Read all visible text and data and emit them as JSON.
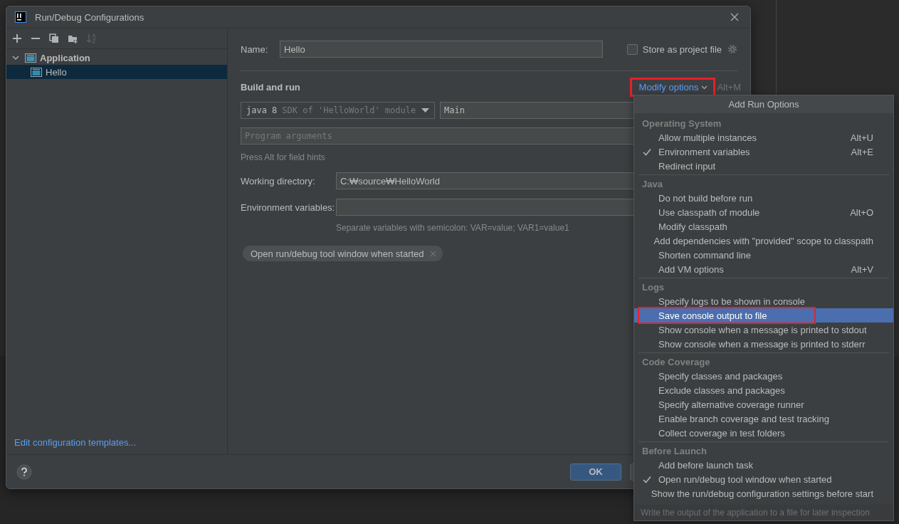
{
  "window": {
    "title": "Run/Debug Configurations"
  },
  "toolbar": [
    {
      "kind": "add",
      "disabled": false
    },
    {
      "kind": "remove",
      "disabled": false
    },
    {
      "kind": "copy",
      "disabled": false
    },
    {
      "kind": "folder",
      "disabled": false
    },
    {
      "kind": "sort",
      "disabled": true
    }
  ],
  "tree": [
    {
      "label": "Application",
      "expanded": true,
      "selected": false,
      "children": [
        {
          "label": "Hello",
          "selected": true
        }
      ]
    }
  ],
  "templates_link": "Edit configuration templates...",
  "form": {
    "name_label": "Name:",
    "name_value": "Hello",
    "store_checkbox": {
      "label": "Store as project file",
      "checked": false
    },
    "section_title": "Build and run",
    "modify_options": {
      "label": "Modify options",
      "shortcut": "Alt+M",
      "highlighted": true
    },
    "jdk": {
      "value": "java 8",
      "detail": "SDK of 'HelloWorld' module"
    },
    "main_class": "Main",
    "program_arguments": {
      "placeholder": "Program arguments"
    },
    "field_hint": "Press Alt for field hints",
    "working_directory": {
      "label": "Working directory:",
      "value": "C:₩source₩HelloWorld"
    },
    "environment_variables": {
      "label": "Environment variables:",
      "hint": "Separate variables with semicolon: VAR=value; VAR1=value1"
    },
    "chips": [
      {
        "label": "Open run/debug tool window when started"
      }
    ]
  },
  "ok_button": "OK",
  "popup": {
    "title": "Add Run Options",
    "groups": [
      {
        "title": "Operating System",
        "items": [
          {
            "label": "Allow multiple instances",
            "shortcut": "Alt+U",
            "checked": false,
            "selected": false,
            "highlighted": false
          },
          {
            "label": "Environment variables",
            "shortcut": "Alt+E",
            "checked": true,
            "selected": false,
            "highlighted": false
          },
          {
            "label": "Redirect input",
            "checked": false,
            "selected": false,
            "highlighted": false
          }
        ]
      },
      {
        "title": "Java",
        "items": [
          {
            "label": "Do not build before run",
            "checked": false,
            "selected": false,
            "highlighted": false
          },
          {
            "label": "Use classpath of module",
            "shortcut": "Alt+O",
            "checked": false,
            "selected": false,
            "highlighted": false
          },
          {
            "label": "Modify classpath",
            "checked": false,
            "selected": false,
            "highlighted": false
          },
          {
            "label": "Add dependencies with \"provided\" scope to classpath",
            "checked": false,
            "selected": false,
            "highlighted": false
          },
          {
            "label": "Shorten command line",
            "checked": false,
            "selected": false,
            "highlighted": false
          },
          {
            "label": "Add VM options",
            "shortcut": "Alt+V",
            "checked": false,
            "selected": false,
            "highlighted": false
          }
        ]
      },
      {
        "title": "Logs",
        "items": [
          {
            "label": "Specify logs to be shown in console",
            "checked": false,
            "selected": false,
            "highlighted": false
          },
          {
            "label": "Save console output to file",
            "checked": false,
            "selected": true,
            "highlighted": true
          },
          {
            "label": "Show console when a message is printed to stdout",
            "checked": false,
            "selected": false,
            "highlighted": false
          },
          {
            "label": "Show console when a message is printed to stderr",
            "checked": false,
            "selected": false,
            "highlighted": false
          }
        ]
      },
      {
        "title": "Code Coverage",
        "items": [
          {
            "label": "Specify classes and packages",
            "checked": false,
            "selected": false,
            "highlighted": false
          },
          {
            "label": "Exclude classes and packages",
            "checked": false,
            "selected": false,
            "highlighted": false
          },
          {
            "label": "Specify alternative coverage runner",
            "checked": false,
            "selected": false,
            "highlighted": false
          },
          {
            "label": "Enable branch coverage and test tracking",
            "checked": false,
            "selected": false,
            "highlighted": false
          },
          {
            "label": "Collect coverage in test folders",
            "checked": false,
            "selected": false,
            "highlighted": false
          }
        ]
      },
      {
        "title": "Before Launch",
        "items": [
          {
            "label": "Add before launch task",
            "checked": false,
            "selected": false,
            "highlighted": false
          },
          {
            "label": "Open run/debug tool window when started",
            "checked": true,
            "selected": false,
            "highlighted": false
          },
          {
            "label": "Show the run/debug configuration settings before start",
            "checked": false,
            "selected": false,
            "highlighted": false
          }
        ]
      }
    ],
    "footer": "Write the output of the application to a file for later inspection"
  }
}
